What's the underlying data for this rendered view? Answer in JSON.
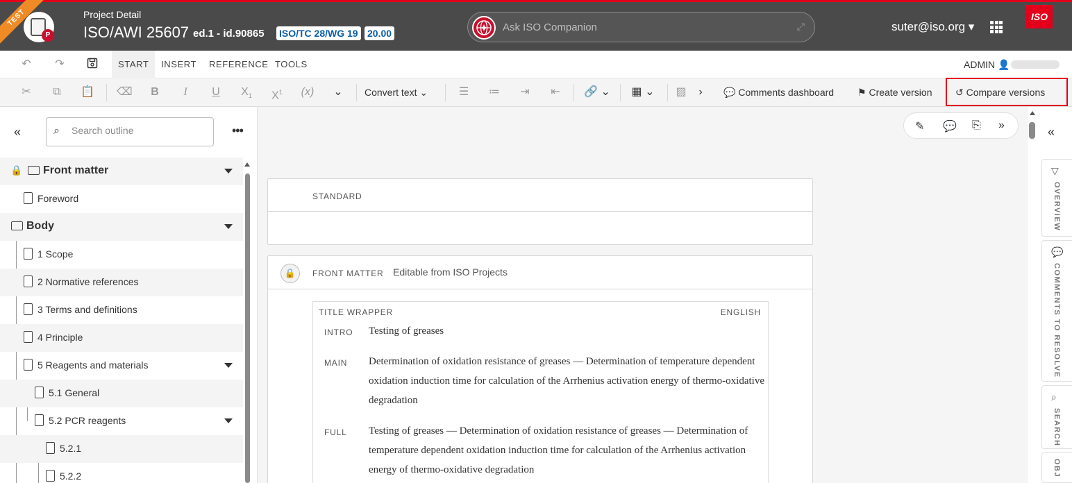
{
  "header": {
    "env_ribbon": "TEST",
    "section_label": "Project Detail",
    "project_title": "ISO/AWI 25607",
    "edition": "ed.1 - id.90865",
    "committee": "ISO/TC 28/WG 19",
    "stage": "20.00",
    "companion_placeholder": "Ask ISO Companion",
    "user": "suter@iso.org ▾",
    "brand_logo": "ISO"
  },
  "tabs": [
    "START",
    "INSERT",
    "REFERENCE",
    "TOOLS"
  ],
  "active_tab": "START",
  "admin_label": "ADMIN",
  "toolbar": {
    "convert_text": "Convert text",
    "comments_dashboard": "Comments dashboard",
    "create_version": "Create version",
    "compare_versions": "Compare versions"
  },
  "outline": {
    "search_placeholder": "Search outline",
    "items": [
      {
        "label": "Front matter",
        "kind": "folder",
        "bold": true
      },
      {
        "label": "Foreword",
        "kind": "file"
      },
      {
        "label": "Body",
        "kind": "folder",
        "bold": true
      },
      {
        "label": "1 Scope",
        "kind": "file"
      },
      {
        "label": "2 Normative references",
        "kind": "file"
      },
      {
        "label": "3 Terms and definitions",
        "kind": "file"
      },
      {
        "label": "4 Principle",
        "kind": "file"
      },
      {
        "label": "5 Reagents and materials",
        "kind": "file"
      },
      {
        "label": "5.1 General",
        "kind": "file"
      },
      {
        "label": "5.2 PCR reagents",
        "kind": "file"
      },
      {
        "label": "5.2.1",
        "kind": "file"
      },
      {
        "label": "5.2.2",
        "kind": "file"
      }
    ]
  },
  "document": {
    "standard_label": "STANDARD",
    "front_matter_label": "FRONT MATTER",
    "editable_note": "Editable from ISO Projects",
    "title_wrapper_label": "TITLE WRAPPER",
    "language": "ENGLISH",
    "intro_label": "INTRO",
    "intro_text": "Testing of greases",
    "main_label": "MAIN",
    "main_text": "Determination of oxidation resistance of greases — Determination of temperature dependent oxidation induction time for calculation of the Arrhenius activation energy of thermo-oxidative degradation",
    "full_label": "FULL",
    "full_text": "Testing of greases — Determination of oxidation resistance of greases — Determination of temperature dependent oxidation induction time for calculation of the Arrhenius activation energy of thermo-oxidative degradation"
  },
  "right_rail": {
    "overview": "OVERVIEW",
    "comments": "COMMENTS TO RESOLVE",
    "search": "SEARCH",
    "last": "OBJ"
  },
  "colors": {
    "header_bg": "#4a4a4a",
    "accent_red": "#e3001b",
    "test_orange": "#f08a24",
    "badge_blue": "#0a5ea8"
  }
}
